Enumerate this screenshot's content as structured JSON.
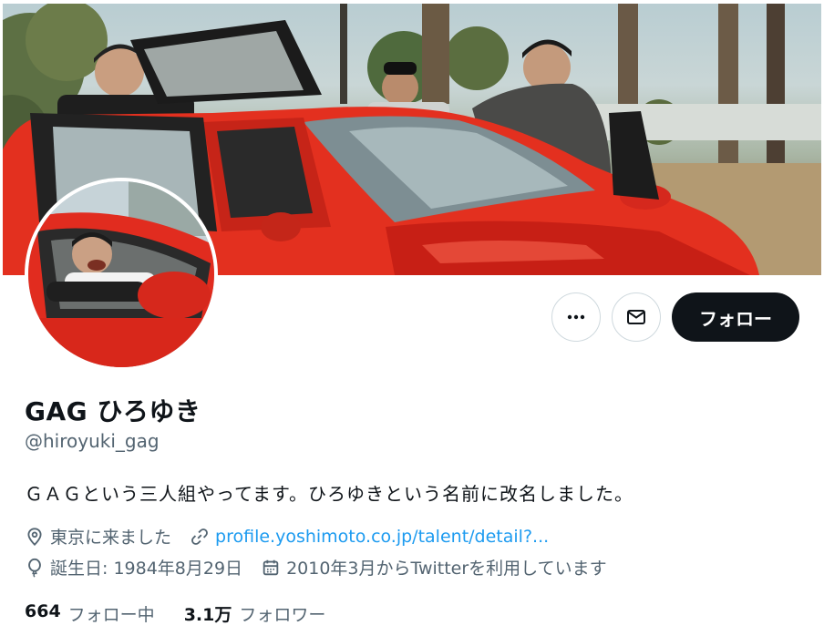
{
  "profile": {
    "display_name": "GAG ひろゆき",
    "handle": "@hiroyuki_gag",
    "bio": "ＧＡＧという三人組やってます。ひろゆきという名前に改名しました。",
    "location": "東京に来ました",
    "website": "profile.yoshimoto.co.jp/talent/detail?...",
    "birthday": "誕生日: 1984年8月29日",
    "joined": "2010年3月からTwitterを利用しています"
  },
  "actions": {
    "more_icon": "more-horizontal-icon",
    "message_icon": "envelope-icon",
    "follow_label": "フォロー"
  },
  "stats": {
    "following_count": "664",
    "following_label": "フォロー中",
    "followers_count": "3.1万",
    "followers_label": "フォロワー"
  },
  "colors": {
    "text": "#0f1419",
    "secondary": "#536471",
    "link": "#1d9bf0",
    "follow_bg": "#0f1419",
    "car_red": "#e52c22"
  }
}
